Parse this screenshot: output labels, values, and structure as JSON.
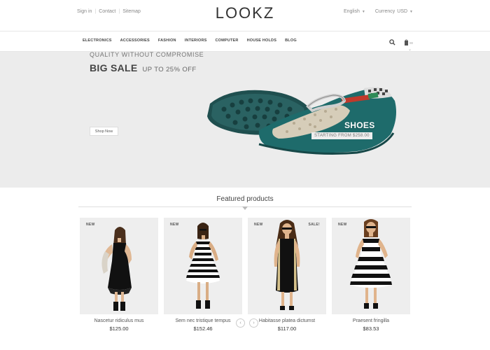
{
  "header": {
    "links": [
      "Sign in",
      "Contact",
      "Sitemap"
    ],
    "logo": "LOOKZ",
    "language": "English",
    "currency_label": "Currency",
    "currency_value": "USD"
  },
  "nav": {
    "items": [
      "ELECTRONICS",
      "ACCESSORIES",
      "FASHION",
      "INTERIORS",
      "COMPUTER",
      "HOUSE HOLDS",
      "BLOG"
    ],
    "icons": [
      "search-icon",
      "cart-icon"
    ]
  },
  "banner": {
    "tagline": "QUALITY WITHOUT COMPROMISE",
    "headline": "BIG SALE",
    "subheadline": "UP TO 25% OFF",
    "button": "Shop Now",
    "product_label": "SHOES",
    "price_label": "STARTING FROM $258.00",
    "colors": {
      "shoe": "#1e6b6b",
      "sole": "#1f4f4f",
      "stripe": "#c0392b"
    }
  },
  "featured": {
    "title": "Featured products",
    "products": [
      {
        "badge": "NEW",
        "sale": "",
        "name": "Nascetur ridiculus mus",
        "price": "$125.00"
      },
      {
        "badge": "NEW",
        "sale": "",
        "name": "Sem nec tristique tempus",
        "price": "$152.46"
      },
      {
        "badge": "NEW",
        "sale": "SALE!",
        "name": "Habitasse platea dictumst",
        "price": "$117.00"
      },
      {
        "badge": "NEW",
        "sale": "",
        "name": "Praesent fringilla",
        "price": "$83.53"
      }
    ]
  },
  "pager": {
    "prev": "‹",
    "next": "›"
  }
}
